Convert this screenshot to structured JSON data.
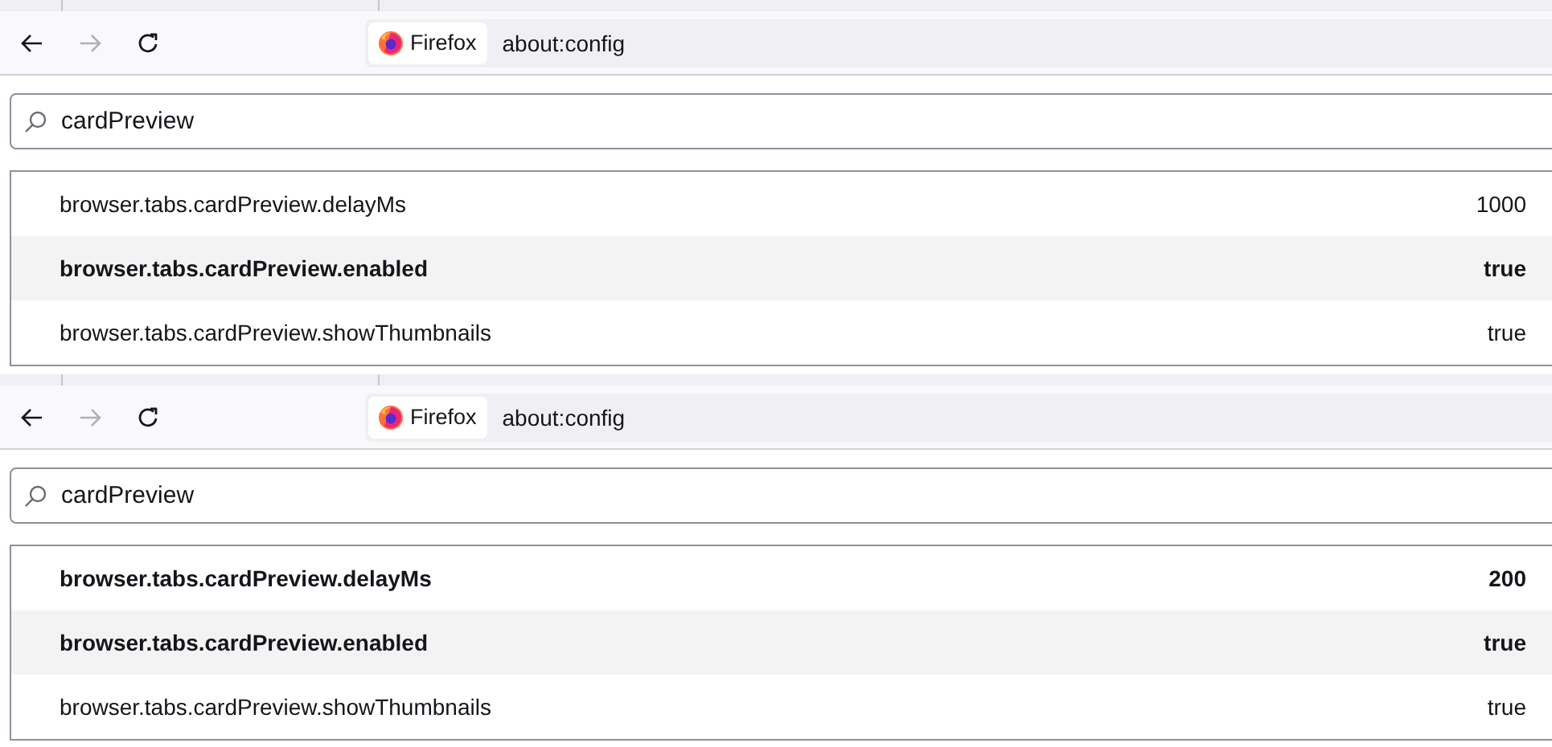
{
  "panels": [
    {
      "nav_buttons": [
        {
          "kind": "back",
          "disabled": false
        },
        {
          "kind": "forward",
          "disabled": true
        },
        {
          "kind": "reload",
          "disabled": false
        }
      ],
      "identity": "Firefox",
      "url": "about:config",
      "search": {
        "value": "cardPreview"
      },
      "prefs": [
        {
          "name": "browser.tabs.cardPreview.delayMs",
          "value": "1000",
          "modified": false
        },
        {
          "name": "browser.tabs.cardPreview.enabled",
          "value": "true",
          "modified": true
        },
        {
          "name": "browser.tabs.cardPreview.showThumbnails",
          "value": "true",
          "modified": false
        }
      ]
    },
    {
      "nav_buttons": [
        {
          "kind": "back",
          "disabled": false
        },
        {
          "kind": "forward",
          "disabled": true
        },
        {
          "kind": "reload",
          "disabled": false
        }
      ],
      "identity": "Firefox",
      "url": "about:config",
      "search": {
        "value": "cardPreview"
      },
      "prefs": [
        {
          "name": "browser.tabs.cardPreview.delayMs",
          "value": "200",
          "modified": true
        },
        {
          "name": "browser.tabs.cardPreview.enabled",
          "value": "true",
          "modified": true
        },
        {
          "name": "browser.tabs.cardPreview.showThumbnails",
          "value": "true",
          "modified": false
        }
      ]
    }
  ]
}
